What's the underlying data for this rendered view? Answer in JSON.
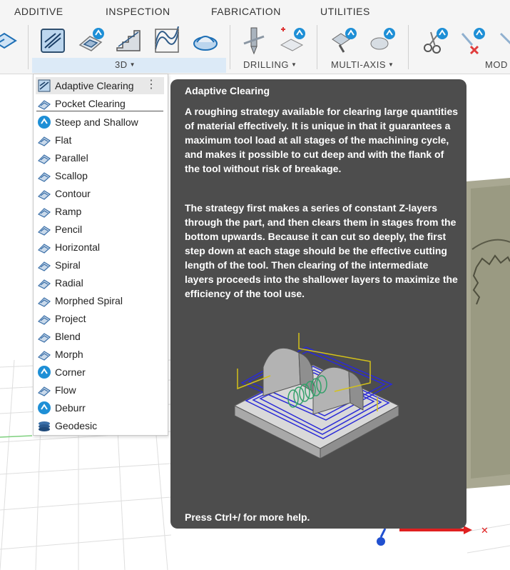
{
  "ribbon": {
    "tabs": [
      "ADDITIVE",
      "INSPECTION",
      "FABRICATION",
      "UTILITIES"
    ],
    "groups": {
      "g3d": "3D",
      "drilling": "DRILLING",
      "multiaxis": "MULTI-AXIS",
      "modify": "MOD"
    },
    "accent_color": "#1e8fd6"
  },
  "menu": {
    "items": [
      {
        "label": "Adaptive Clearing",
        "icon": "adaptive-clearing-icon"
      },
      {
        "label": "Pocket Clearing",
        "icon": "pocket-clearing-icon"
      },
      {
        "label": "Steep and Shallow",
        "icon": "steep-shallow-icon"
      },
      {
        "label": "Flat",
        "icon": "flat-icon"
      },
      {
        "label": "Parallel",
        "icon": "parallel-icon"
      },
      {
        "label": "Scallop",
        "icon": "scallop-icon"
      },
      {
        "label": "Contour",
        "icon": "contour-icon"
      },
      {
        "label": "Ramp",
        "icon": "ramp-icon"
      },
      {
        "label": "Pencil",
        "icon": "pencil-icon"
      },
      {
        "label": "Horizontal",
        "icon": "horizontal-icon"
      },
      {
        "label": "Spiral",
        "icon": "spiral-icon"
      },
      {
        "label": "Radial",
        "icon": "radial-icon"
      },
      {
        "label": "Morphed Spiral",
        "icon": "morphed-spiral-icon"
      },
      {
        "label": "Project",
        "icon": "project-icon"
      },
      {
        "label": "Blend",
        "icon": "blend-icon"
      },
      {
        "label": "Morph",
        "icon": "morph-icon"
      },
      {
        "label": "Corner",
        "icon": "corner-icon"
      },
      {
        "label": "Flow",
        "icon": "flow-icon"
      },
      {
        "label": "Deburr",
        "icon": "deburr-icon"
      },
      {
        "label": "Geodesic",
        "icon": "geodesic-icon"
      }
    ]
  },
  "tooltip": {
    "title": "Adaptive Clearing",
    "paragraph1": "A roughing strategy available for clearing large quantities of material effectively. It is unique in that it guarantees a maximum tool load at all stages of the machining cycle, and makes it possible to cut deep and with the flank of the tool without risk of breakage.",
    "paragraph2": "The strategy first makes a series of constant Z-layers through the part, and then clears them in stages from the bottom upwards. Because it can cut so deeply, the first step down at each stage should be the effective cutting length of the tool. Then clearing of the intermediate layers proceeds into the shallower layers to maximize the efficiency of the tool use.",
    "help": "Press Ctrl+/ for more help."
  }
}
